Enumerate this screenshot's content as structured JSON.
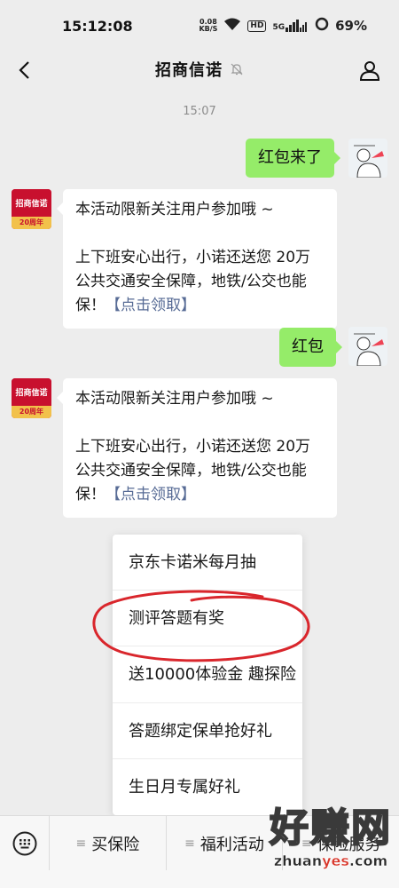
{
  "status_bar": {
    "time": "15:12:08",
    "net_speed_value": "0.08",
    "net_speed_unit": "KB/S",
    "hd_badge": "HD",
    "signal_label": "5G",
    "battery": "69%",
    "icons": [
      "wifi-icon",
      "signal-icon",
      "battery-icon"
    ]
  },
  "header": {
    "title": "招商信诺",
    "icons": [
      "back-icon",
      "mute-icon",
      "profile-icon"
    ]
  },
  "chat": {
    "timestamp": "15:07",
    "sent_1": "红包来了",
    "recv_1": {
      "line1": "本活动限新关注用户参加哦 ~",
      "body": "上下班安心出行，小诺还送您 20万公共交通安全保障，地铁/公交也能保！",
      "link": "【点击领取】"
    },
    "sent_2": "红包",
    "recv_2": {
      "line1": "本活动限新关注用户参加哦 ~",
      "body": "上下班安心出行，小诺还送您 20万公共交通安全保障，地铁/公交也能保！",
      "link": "【点击领取】"
    },
    "bot_avatar": {
      "brand": "招商信诺",
      "anniversary": "20周年"
    }
  },
  "popup_menu": {
    "items": [
      "京东卡诺米每月抽",
      "测评答题有奖",
      "送10000体验金 趣探险",
      "答题绑定保单抢好礼",
      "生日月专属好礼"
    ]
  },
  "bottom_bar": {
    "tab_1": "买保险",
    "tab_2": "福利活动",
    "tab_3": "保险服务"
  },
  "watermark": {
    "text": "好赚网",
    "url_1": "zhuan",
    "url_2": "yes",
    "url_3": ".com"
  },
  "colors": {
    "sent_bubble": "#95ec69",
    "link": "#576b95",
    "annotation_circle": "#d9262c",
    "brand_red": "#c8102e"
  }
}
